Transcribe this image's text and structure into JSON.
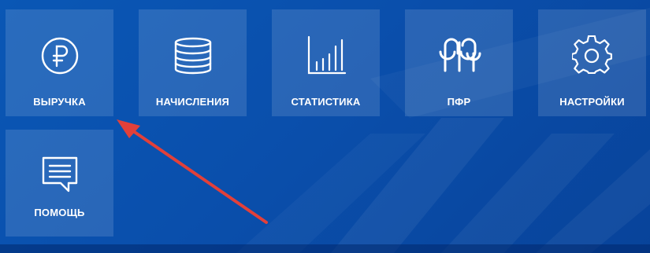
{
  "tiles": [
    {
      "label": "ВЫРУЧКА",
      "icon": "ruble-icon"
    },
    {
      "label": "НАЧИСЛЕНИЯ",
      "icon": "coin-stack-icon"
    },
    {
      "label": "СТАТИСТИКА",
      "icon": "bar-chart-icon"
    },
    {
      "label": "ПФР",
      "icon": "pfr-logo-icon"
    },
    {
      "label": "НАСТРОЙКИ",
      "icon": "gear-icon"
    },
    {
      "label": "ПОМОЩЬ",
      "icon": "chat-bubble-icon"
    }
  ],
  "colors": {
    "background": "#0a4fac",
    "tile": "rgba(255,255,255,0.13)",
    "text": "#ffffff",
    "annotation_arrow": "#e2403a"
  }
}
